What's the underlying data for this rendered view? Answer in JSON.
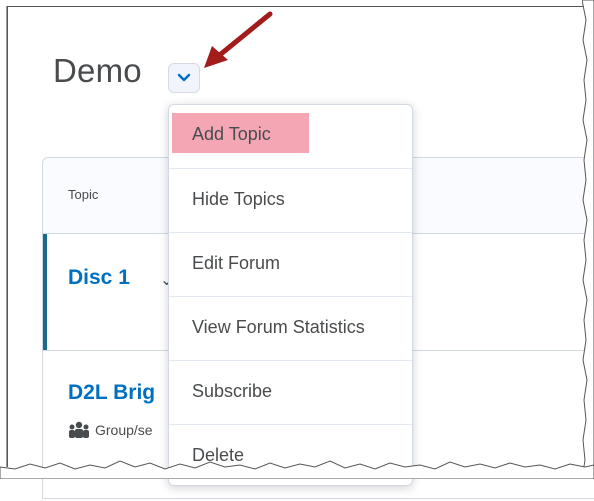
{
  "page": {
    "title": "Demo"
  },
  "table": {
    "header": {
      "topic": "Topic"
    },
    "rows": [
      {
        "title": "Disc 1"
      },
      {
        "title": "D2L Brig",
        "meta": "Group/se"
      }
    ]
  },
  "menu": {
    "items": [
      {
        "label": "Add Topic",
        "highlighted": true
      },
      {
        "label": "Hide Topics"
      },
      {
        "label": "Edit Forum"
      },
      {
        "label": "View Forum Statistics"
      },
      {
        "label": "Subscribe"
      },
      {
        "label": "Delete"
      }
    ]
  },
  "colors": {
    "link": "#006fbf",
    "highlight": "#f4a6b4",
    "annotation_arrow": "#a31c1c"
  },
  "icons": {
    "dropdown": "chevron-down-icon",
    "group": "group-icon",
    "annotation": "annotation-arrow-icon"
  }
}
